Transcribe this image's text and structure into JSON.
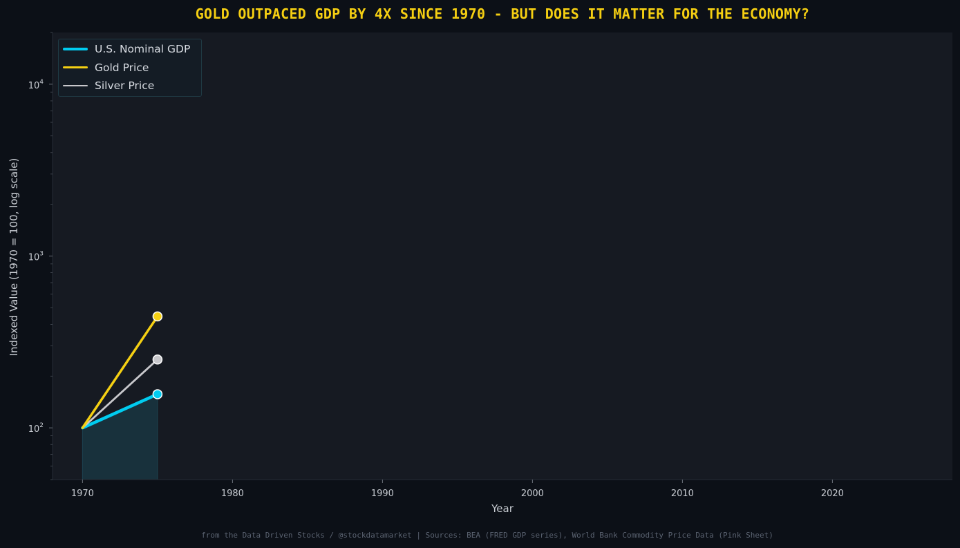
{
  "title": "GOLD OUTPACED GDP BY 4X SINCE 1970 - BUT DOES IT MATTER FOR THE ECONOMY?",
  "footer": "from the Data Driven Stocks / @stockdatamarket  |  Sources: BEA (FRED GDP series), World Bank Commodity Price Data (Pink Sheet)",
  "colors": {
    "background": "#0c1017",
    "plot_background": "#161a22",
    "title": "#f5cf12",
    "gdp": "#00ccf0",
    "gold": "#f5d013",
    "silver": "#c8c8cc"
  },
  "chart_data": {
    "type": "line",
    "title": "GOLD OUTPACED GDP BY 4X SINCE 1970 - BUT DOES IT MATTER FOR THE ECONOMY?",
    "xlabel": "Year",
    "ylabel": "Indexed Value (1970 = 100, log scale)",
    "xlim": [
      1968,
      2028
    ],
    "ylim": [
      50,
      20000
    ],
    "yscale": "log",
    "x_ticks": [
      1970,
      1980,
      1990,
      2000,
      2010,
      2020
    ],
    "y_ticks": [
      {
        "value": 100,
        "base": "10",
        "exp": "2"
      },
      {
        "value": 1000,
        "base": "10",
        "exp": "3"
      },
      {
        "value": 10000,
        "base": "10",
        "exp": "4"
      }
    ],
    "grid": false,
    "legend_position": "top-left",
    "series": [
      {
        "name": "U.S. Nominal GDP",
        "color": "#00ccf0",
        "x": [
          1970,
          1975
        ],
        "values": [
          100,
          157
        ],
        "line_width": 4.5,
        "fill": true
      },
      {
        "name": "Gold Price",
        "color": "#f5d013",
        "x": [
          1970,
          1975
        ],
        "values": [
          100,
          445
        ],
        "line_width": 3.5,
        "fill": false
      },
      {
        "name": "Silver Price",
        "color": "#c8c8cc",
        "x": [
          1970,
          1975
        ],
        "values": [
          100,
          250
        ],
        "line_width": 2.8,
        "fill": false
      }
    ]
  }
}
